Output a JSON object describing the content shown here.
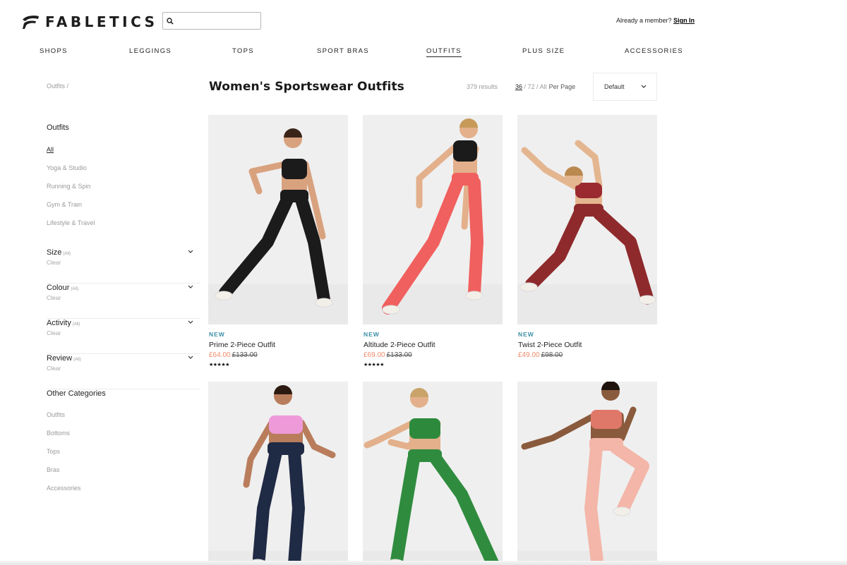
{
  "header": {
    "brand": "FABLETICS",
    "search_placeholder": "",
    "member_prompt": "Already a member?",
    "sign_in_label": "Sign In"
  },
  "nav": {
    "items": [
      {
        "label": "SHOPS"
      },
      {
        "label": "LEGGINGS"
      },
      {
        "label": "TOPS"
      },
      {
        "label": "SPORT BRAS"
      },
      {
        "label": "OUTFITS",
        "active": true
      },
      {
        "label": "PLUS SIZE"
      },
      {
        "label": "ACCESSORIES"
      }
    ]
  },
  "sidebar": {
    "breadcrumb": "Outfits /",
    "category_heading": "Outfits",
    "category_links": [
      {
        "label": "All",
        "active": true
      },
      {
        "label": "Yoga & Studio"
      },
      {
        "label": "Running & Spin"
      },
      {
        "label": "Gym & Train"
      },
      {
        "label": "Lifestyle & Travel"
      }
    ],
    "filters": [
      {
        "title": "Size",
        "qualifier": "(All)",
        "clear_label": "Clear"
      },
      {
        "title": "Colour",
        "qualifier": "(All)",
        "clear_label": "Clear"
      },
      {
        "title": "Activity",
        "qualifier": "(All)",
        "clear_label": "Clear"
      },
      {
        "title": "Review",
        "qualifier": "(All)",
        "clear_label": "Clear"
      }
    ],
    "other_heading": "Other Categories",
    "other_links": [
      {
        "label": "Outfits"
      },
      {
        "label": "Bottoms"
      },
      {
        "label": "Tops"
      },
      {
        "label": "Bras"
      },
      {
        "label": "Accessories"
      }
    ]
  },
  "main": {
    "title": "Women's Sportswear Outfits",
    "results_count": "379 results",
    "per_page": {
      "current": "36",
      "sep1": " / ",
      "opt2": "72",
      "sep2": " / ",
      "opt3": "All",
      "label": "Per Page"
    },
    "sort_value": "Default"
  },
  "products": [
    {
      "badge": "NEW",
      "name": "Prime 2-Piece Outfit",
      "sale_price": "£64.00",
      "was_price": "£133.00",
      "stars": "★★★★★",
      "rating": 4.5,
      "colors": {
        "top": "#1b1b1b",
        "bottom": "#1b1b1b",
        "skin": "#d9a27f",
        "hair": "#3a2418"
      }
    },
    {
      "badge": "NEW",
      "name": "Altitude 2-Piece Outfit",
      "sale_price": "£69.00",
      "was_price": "£133.00",
      "stars": "★★★★★",
      "rating": 4.5,
      "colors": {
        "top": "#1b1b1b",
        "bottom": "#f0605e",
        "skin": "#e3b08b",
        "hair": "#c79a5a"
      }
    },
    {
      "badge": "NEW",
      "name": "Twist 2-Piece Outfit",
      "sale_price": "£49.00",
      "was_price": "£98.00",
      "stars": "",
      "rating": null,
      "colors": {
        "top": "#9a2a2f",
        "bottom": "#8e2a2c",
        "skin": "#e4b690",
        "hair": "#b98950"
      }
    },
    {
      "badge": "",
      "name": "",
      "sale_price": "",
      "was_price": "",
      "stars": "",
      "rating": null,
      "colors": {
        "top": "#ee9ad8",
        "bottom": "#1f2a44",
        "skin": "#b97d5c",
        "hair": "#2c1a10"
      }
    },
    {
      "badge": "",
      "name": "",
      "sale_price": "",
      "was_price": "",
      "stars": "",
      "rating": null,
      "colors": {
        "top": "#2d8a3c",
        "bottom": "#2f8c3e",
        "skin": "#e3b08b",
        "hair": "#c9a36a"
      }
    },
    {
      "badge": "",
      "name": "",
      "sale_price": "",
      "was_price": "",
      "stars": "",
      "rating": null,
      "colors": {
        "top": "#e0786a",
        "bottom": "#f3b6a8",
        "skin": "#8a5a3c",
        "hair": "#1e120c"
      }
    }
  ]
}
